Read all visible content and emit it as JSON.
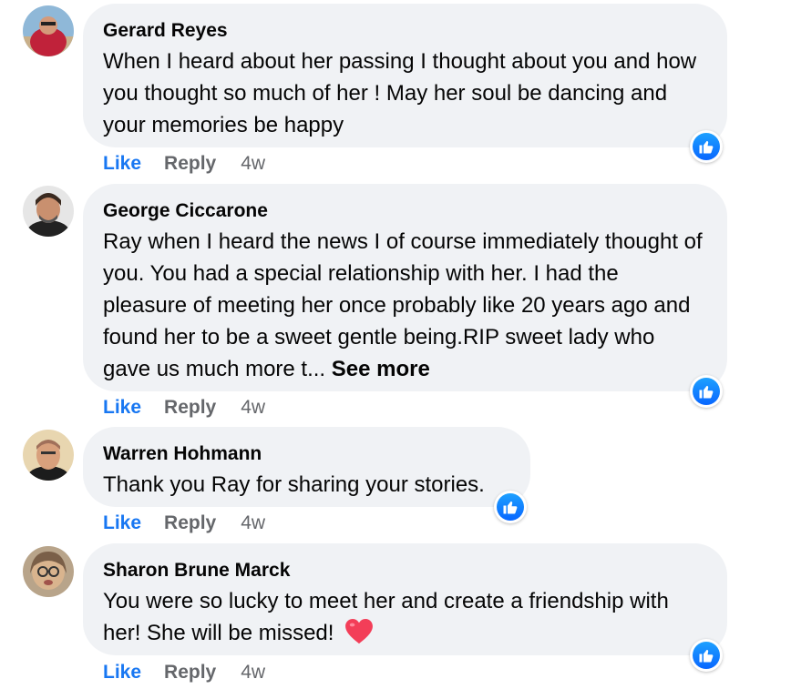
{
  "colors": {
    "like_blue": "#1877f2",
    "bubble_bg": "#f0f2f5",
    "meta_gray": "#65676b",
    "heart_red": "#f33e58"
  },
  "comments": [
    {
      "author": "Gerard Reyes",
      "text": "When I heard about her passing I thought about you and how you thought so much of her ! May her soul be dancing and your memories be happy",
      "like": "Like",
      "reply": "Reply",
      "time": "4w",
      "reaction": "like-icon"
    },
    {
      "author": "George Ciccarone",
      "text": "Ray when I heard the news I of course immediately thought of you. You had a special relationship with her. I had the pleasure of meeting her once probably like 20 years ago and found her to be a sweet gentle being.RIP sweet lady who gave us much more t...",
      "see_more": "See more",
      "like": "Like",
      "reply": "Reply",
      "time": "4w",
      "reaction": "like-icon"
    },
    {
      "author": "Warren Hohmann",
      "text": "Thank you Ray for sharing your stories.",
      "like": "Like",
      "reply": "Reply",
      "time": "4w",
      "reaction": "like-icon"
    },
    {
      "author": "Sharon Brune Marck",
      "text": "You were so lucky to meet her and create a friendship with her! She will be missed!",
      "emoji": "heart-emoji",
      "like": "Like",
      "reply": "Reply",
      "time": "4w",
      "reaction": "like-icon"
    }
  ]
}
